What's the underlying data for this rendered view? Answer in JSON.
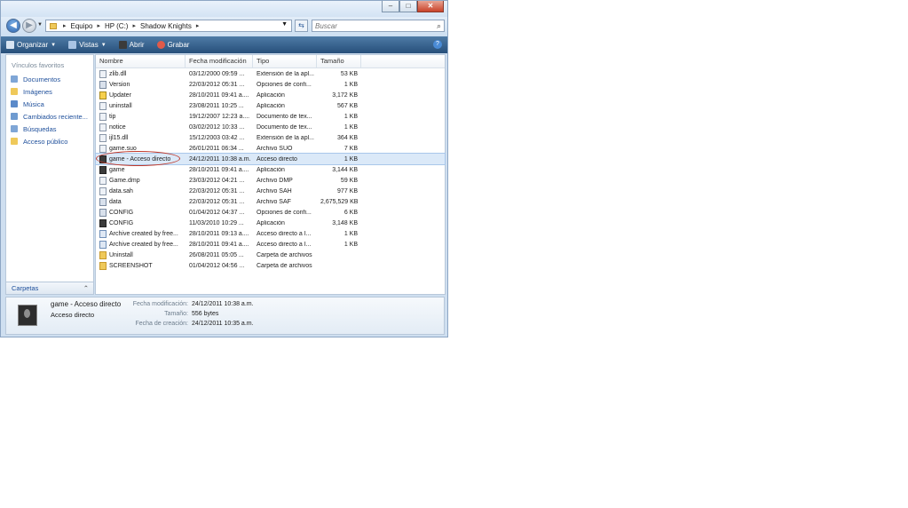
{
  "window": {
    "buttons": {
      "minimize": "–",
      "maximize": "□",
      "close": "✕"
    }
  },
  "address": {
    "breadcrumbs": [
      "Equipo",
      "HP (C:)",
      "Shadow Knights"
    ],
    "search_placeholder": "Buscar"
  },
  "toolbar": {
    "organize": "Organizar",
    "views": "Vistas",
    "open": "Abrir",
    "burn": "Grabar"
  },
  "sidebar": {
    "heading": "Vínculos favoritos",
    "items": [
      {
        "label": "Documentos",
        "icon": "documents-icon"
      },
      {
        "label": "Imágenes",
        "icon": "pictures-icon"
      },
      {
        "label": "Música",
        "icon": "music-icon"
      },
      {
        "label": "Cambiados reciente...",
        "icon": "recent-icon"
      },
      {
        "label": "Búsquedas",
        "icon": "searches-icon"
      },
      {
        "label": "Acceso público",
        "icon": "public-icon"
      }
    ],
    "folders_label": "Carpetas"
  },
  "columns": [
    "Nombre",
    "Fecha modificación",
    "Tipo",
    "Tamaño"
  ],
  "files": [
    {
      "name": "zlib.dll",
      "date": "03/12/2000 09:59 ...",
      "type": "Extensión de la apl...",
      "size": "53 KB",
      "icon": "dll"
    },
    {
      "name": "Version",
      "date": "22/03/2012 05:31 ...",
      "type": "Opciones de confi...",
      "size": "1 KB",
      "icon": "cfg"
    },
    {
      "name": "Updater",
      "date": "28/10/2011 09:41 a....",
      "type": "Aplicación",
      "size": "3,172 KB",
      "icon": "updater"
    },
    {
      "name": "uninstall",
      "date": "23/08/2011 10:25 ...",
      "type": "Aplicación",
      "size": "567 KB",
      "icon": "dll"
    },
    {
      "name": "tip",
      "date": "19/12/2007 12:23 a....",
      "type": "Documento de tex...",
      "size": "1 KB",
      "icon": "dll"
    },
    {
      "name": "notice",
      "date": "03/02/2012 10:33 ...",
      "type": "Documento de tex...",
      "size": "1 KB",
      "icon": "dll"
    },
    {
      "name": "ijl15.dll",
      "date": "15/12/2003 03:42 ...",
      "type": "Extensión de la apl...",
      "size": "364 KB",
      "icon": "dll"
    },
    {
      "name": "game.suo",
      "date": "26/01/2011 06:34 ...",
      "type": "Archivo SUO",
      "size": "7 KB",
      "icon": "dll"
    },
    {
      "name": "game - Acceso directo",
      "date": "24/12/2011 10:38 a.m.",
      "type": "Acceso directo",
      "size": "1 KB",
      "icon": "app",
      "selected": true
    },
    {
      "name": "game",
      "date": "28/10/2011 09:41 a....",
      "type": "Aplicación",
      "size": "3,144 KB",
      "icon": "app"
    },
    {
      "name": "Game.dmp",
      "date": "23/03/2012 04:21 ...",
      "type": "Archivo DMP",
      "size": "59 KB",
      "icon": "dll"
    },
    {
      "name": "data.sah",
      "date": "22/03/2012 05:31 ...",
      "type": "Archivo SAH",
      "size": "977 KB",
      "icon": "dll"
    },
    {
      "name": "data",
      "date": "22/03/2012 05:31 ...",
      "type": "Archivo SAF",
      "size": "2,675,529 KB",
      "icon": "cfg"
    },
    {
      "name": "CONFIG",
      "date": "01/04/2012 04:37 ...",
      "type": "Opciones de confi...",
      "size": "6 KB",
      "icon": "cfg"
    },
    {
      "name": "CONFIG",
      "date": "11/03/2010 10:29 ...",
      "type": "Aplicación",
      "size": "3,148 KB",
      "icon": "app"
    },
    {
      "name": "Archive created by free...",
      "date": "28/10/2011 09:13 a....",
      "type": "Acceso directo a I...",
      "size": "1 KB",
      "icon": "link"
    },
    {
      "name": "Archive created by free...",
      "date": "28/10/2011 09:41 a....",
      "type": "Acceso directo a I...",
      "size": "1 KB",
      "icon": "link"
    },
    {
      "name": "Uninstall",
      "date": "26/08/2011 05:05 ...",
      "type": "Carpeta de archivos",
      "size": "",
      "icon": "folder"
    },
    {
      "name": "SCREENSHOT",
      "date": "01/04/2012 04:56 ...",
      "type": "Carpeta de archivos",
      "size": "",
      "icon": "folder"
    }
  ],
  "details": {
    "name": "game - Acceso directo",
    "type": "Acceso directo",
    "modified_label": "Fecha modificación:",
    "modified_value": "24/12/2011 10:38 a.m.",
    "size_label": "Tamaño:",
    "size_value": "556 bytes",
    "created_label": "Fecha de creación:",
    "created_value": "24/12/2011 10:35 a.m."
  },
  "colors": {
    "accent": "#274f7a",
    "link": "#1e4f9b",
    "selection": "#dbe9f8",
    "annotation": "#c0392b"
  }
}
